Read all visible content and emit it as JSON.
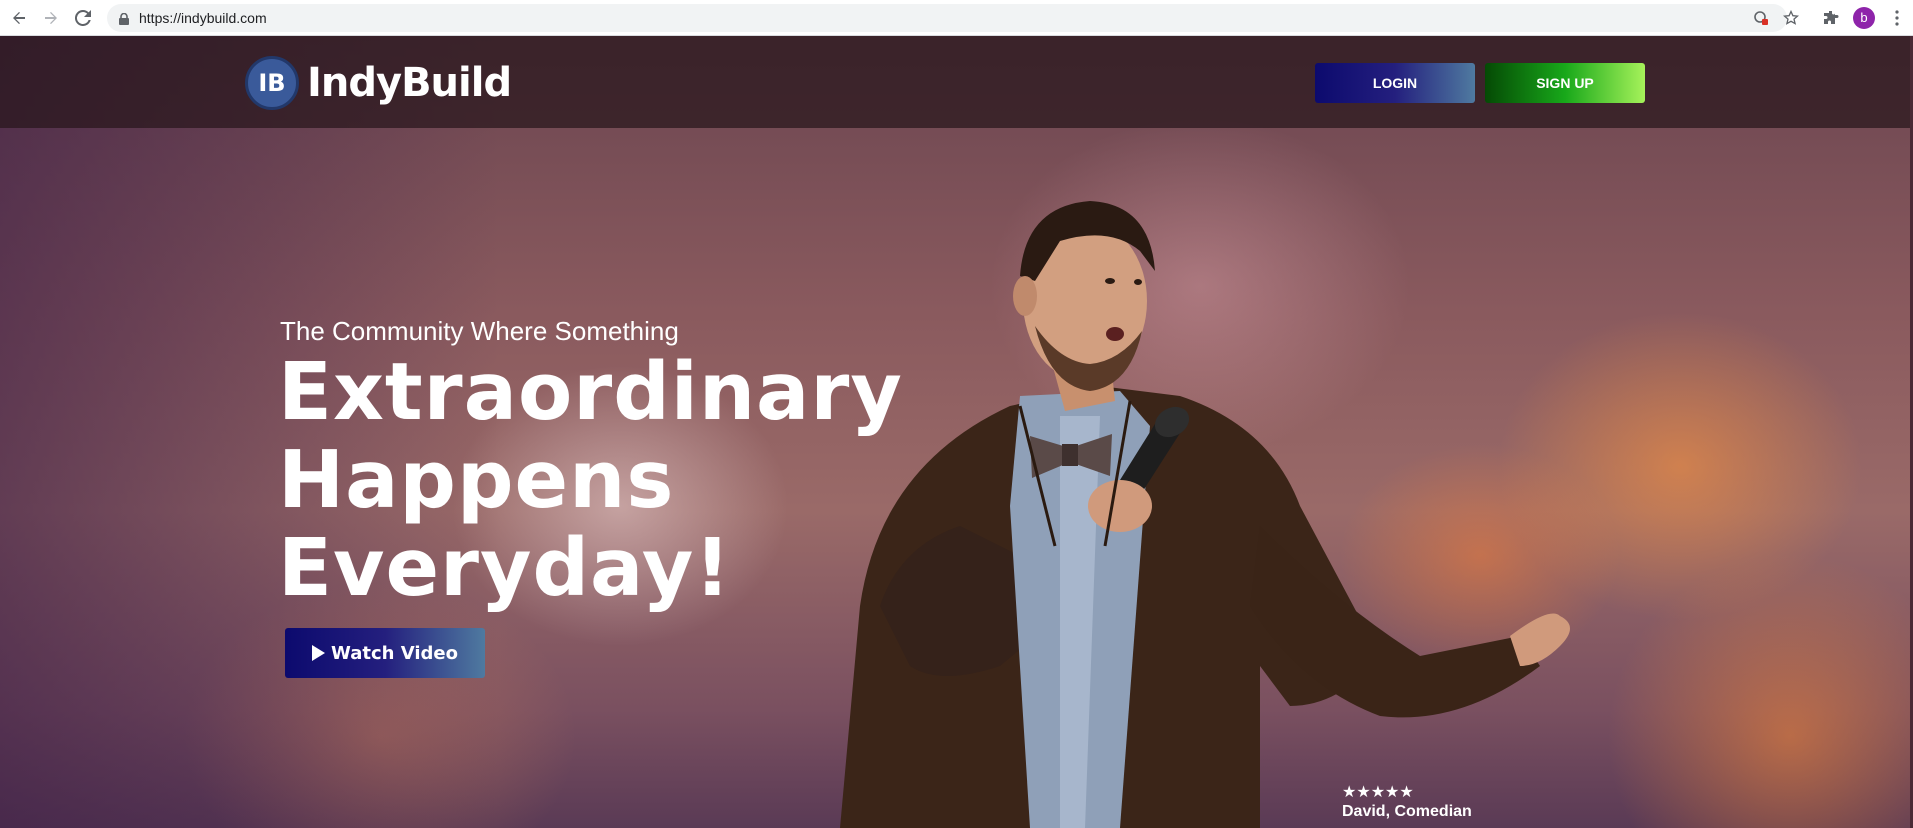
{
  "browser": {
    "url": "https://indybuild.com",
    "profile_initial": "b",
    "icons": [
      "back-icon",
      "forward-icon",
      "reload-icon",
      "lock-icon",
      "blocked-icon",
      "star-icon",
      "extensions-icon",
      "menu-icon"
    ]
  },
  "header": {
    "logo_mark": "IB",
    "logo_text": "IndyBuild",
    "login_label": "LOGIN",
    "signup_label": "SIGN UP"
  },
  "hero": {
    "subtitle": "The Community Where Something",
    "title_lines": [
      "Extraordinary",
      "Happens",
      "Everyday!"
    ],
    "watch_video_label": "Watch Video"
  },
  "testimonial": {
    "stars": "★★★★★",
    "rating": 5,
    "name": "David, Comedian"
  },
  "colors": {
    "login_gradient": [
      "#0c0a6e",
      "#4f7aa0"
    ],
    "signup_gradient": [
      "#054a05",
      "#a6f25a"
    ],
    "avatar": "#8e24aa"
  }
}
